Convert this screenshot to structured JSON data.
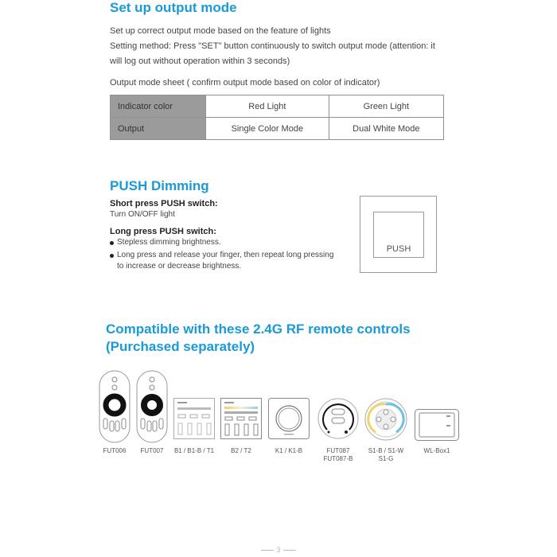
{
  "section1": {
    "title": "Set up output mode",
    "line1": "Set up correct output mode based on the feature of lights",
    "line2": "Setting method: Press \"SET\" button continuously to switch output mode (attention: it",
    "line3": "will log out without operation within 3 seconds)",
    "sheet_caption": "Output mode sheet ( confirm output mode based on color of indicator)",
    "table": {
      "rows": [
        {
          "header": "Indicator color",
          "cells": [
            "Red Light",
            "Green Light"
          ]
        },
        {
          "header": "Output",
          "cells": [
            "Single Color Mode",
            "Dual White Mode"
          ]
        }
      ]
    }
  },
  "section2": {
    "title": "PUSH Dimming",
    "short_heading": "Short press PUSH switch:",
    "short_text": "Turn ON/OFF light",
    "long_heading": "Long press PUSH switch:",
    "bullets": [
      "Stepless dimming brightness.",
      "Long press and release your finger, then repeat long pressing to increase or decrease brightness."
    ],
    "push_label": "PUSH"
  },
  "section3": {
    "title_line1": "Compatible with these 2.4G RF remote controls",
    "title_line2": "(Purchased separately)",
    "remotes": [
      {
        "label": "FUT006",
        "icon": "oval-remote-icon"
      },
      {
        "label": "FUT007",
        "icon": "oval-remote-icon"
      },
      {
        "label": "B1 / B1-B / T1",
        "icon": "wall-panel-icon"
      },
      {
        "label": "B2 / T2",
        "icon": "wall-panel-cct-icon"
      },
      {
        "label": "K1 / K1-B",
        "icon": "knob-panel-icon"
      },
      {
        "label": "FUT087\nFUT087-B",
        "icon": "round-remote-icon"
      },
      {
        "label": "S1-B / S1-W\nS1-G",
        "icon": "round-touch-panel-icon"
      },
      {
        "label": "WL-Box1",
        "icon": "wl-box-icon"
      }
    ]
  },
  "footer": {
    "page_number": "3"
  }
}
